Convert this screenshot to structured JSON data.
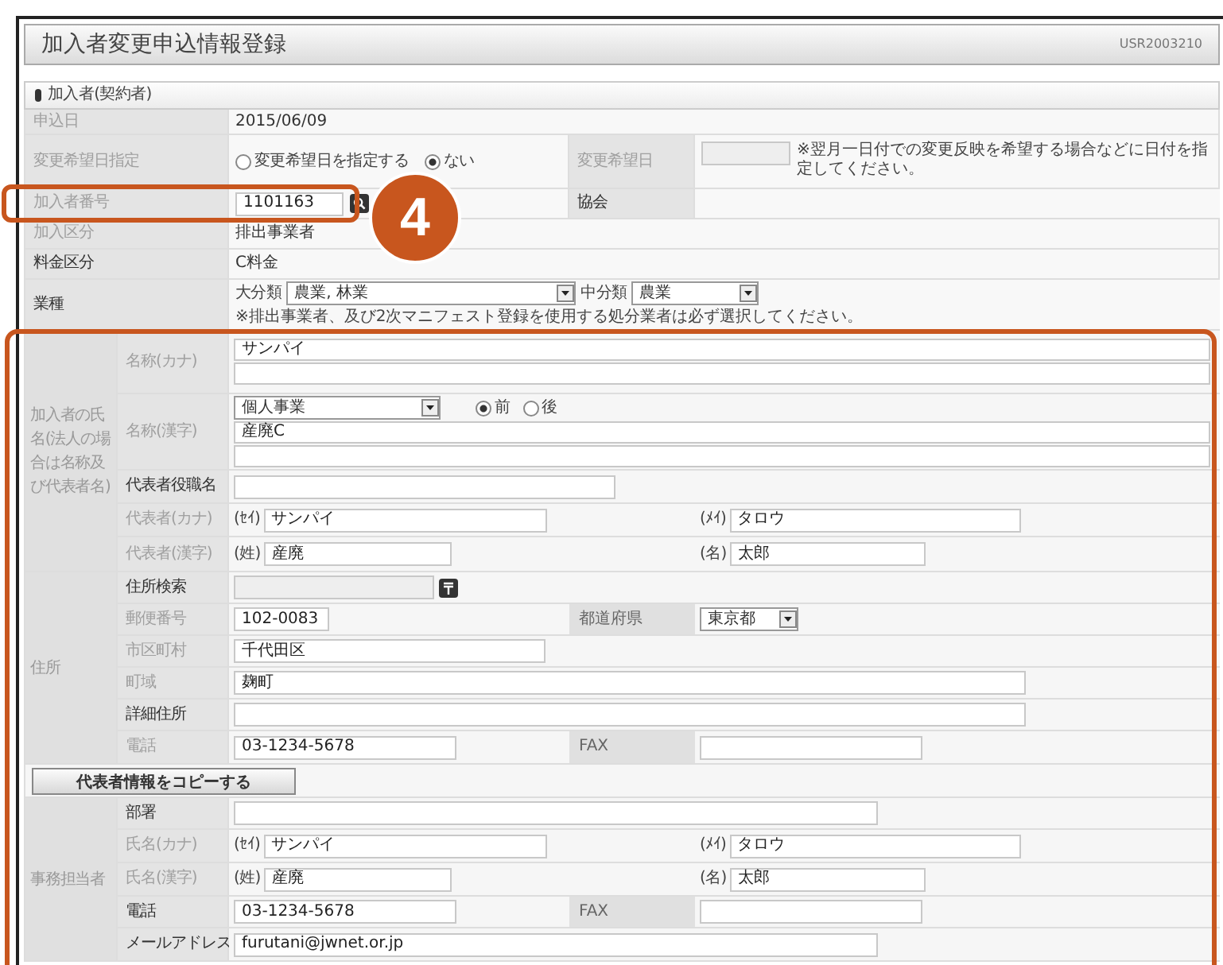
{
  "header": {
    "title": "加入者変更申込情報登録",
    "screen_id": "USR2003210"
  },
  "section_title": "加入者(契約者)",
  "application_date": {
    "label": "申込日",
    "required": false,
    "value": "2015/06/09"
  },
  "change_request": {
    "label": "変更希望日指定",
    "required": false,
    "options": [
      {
        "label": "変更希望日を指定する",
        "selected": false
      },
      {
        "label": "ない",
        "selected": true
      }
    ],
    "date_label": "変更希望日",
    "note": "※翌月一日付での変更反映を希望する場合などに日付を指定してください。"
  },
  "member_number": {
    "label": "加入者番号",
    "required": false,
    "value": "1101163",
    "association_label": "協会"
  },
  "member_type": {
    "label": "加入区分",
    "required": false,
    "value": "排出事業者"
  },
  "fee_type": {
    "label": "料金区分",
    "required": true,
    "value": "C料金"
  },
  "industry": {
    "label": "業種",
    "required": true,
    "major_label": "大分類",
    "major_value": "農業, 林業",
    "minor_label": "中分類",
    "minor_value": "農業",
    "note": "※排出事業者、及び2次マニフェスト登録を使用する処分業者は必ず選択してください。"
  },
  "name_group": {
    "label": "加入者の氏名(法人の場合は名称及び代表者名)",
    "rows": [
      {
        "kind": "kana",
        "label": "名称(カナ)",
        "required": false,
        "value": "サンパイ"
      },
      {
        "kind": "kanji",
        "label": "名称(漢字)",
        "required": false,
        "select_value": "個人事業",
        "options": [
          {
            "label": "前",
            "selected": true
          },
          {
            "label": "後",
            "selected": false
          }
        ],
        "value": "産廃C"
      },
      {
        "kind": "medium",
        "label": "代表者役職名",
        "required": true
      },
      {
        "kind": "kanapair",
        "label": "代表者(カナ)",
        "required": false,
        "left_prefix": "(ｾｲ)",
        "left_value": "サンパイ",
        "right_prefix": "(ﾒｲ)",
        "right_value": "タロウ"
      },
      {
        "kind": "kanjipair",
        "label": "代表者(漢字)",
        "required": false,
        "left_prefix": "(姓)",
        "left_value": "産廃",
        "right_prefix": "(名)",
        "right_value": "太郎"
      }
    ]
  },
  "address_group": {
    "label": "住所",
    "rows": [
      {
        "kind": "search",
        "label": "住所検索",
        "required": true
      },
      {
        "kind": "zip",
        "label": "郵便番号",
        "required": false,
        "value": "102-0083",
        "side_label": "都道府県",
        "side_value": "東京都"
      },
      {
        "kind": "short",
        "label": "市区町村",
        "required": false,
        "value": "千代田区"
      },
      {
        "kind": "long",
        "label": "町域",
        "required": false,
        "value": "麹町"
      },
      {
        "kind": "long",
        "label": "詳細住所",
        "required": true
      },
      {
        "kind": "phone",
        "label": "電話",
        "required": false,
        "value": "03-1234-5678",
        "side_label": "FAX"
      }
    ]
  },
  "copy_button": "代表者情報をコピーする",
  "contact_group": {
    "label": "事務担当者",
    "rows": [
      {
        "kind": "wide",
        "label": "部署",
        "required": true
      },
      {
        "kind": "kanapair",
        "label": "氏名(カナ)",
        "required": false,
        "left_prefix": "(ｾｲ)",
        "left_value": "サンパイ",
        "right_prefix": "(ﾒｲ)",
        "right_value": "タロウ"
      },
      {
        "kind": "kanjipair",
        "label": "氏名(漢字)",
        "required": false,
        "left_prefix": "(姓)",
        "left_value": "産廃",
        "right_prefix": "(名)",
        "right_value": "太郎"
      },
      {
        "kind": "phone",
        "label": "電話",
        "required": true,
        "value": "03-1234-5678",
        "side_label": "FAX"
      },
      {
        "kind": "wide",
        "label": "メールアドレス",
        "required": true,
        "value": "furutani@jwnet.or.jp"
      }
    ]
  },
  "callout": {
    "number": "4"
  }
}
